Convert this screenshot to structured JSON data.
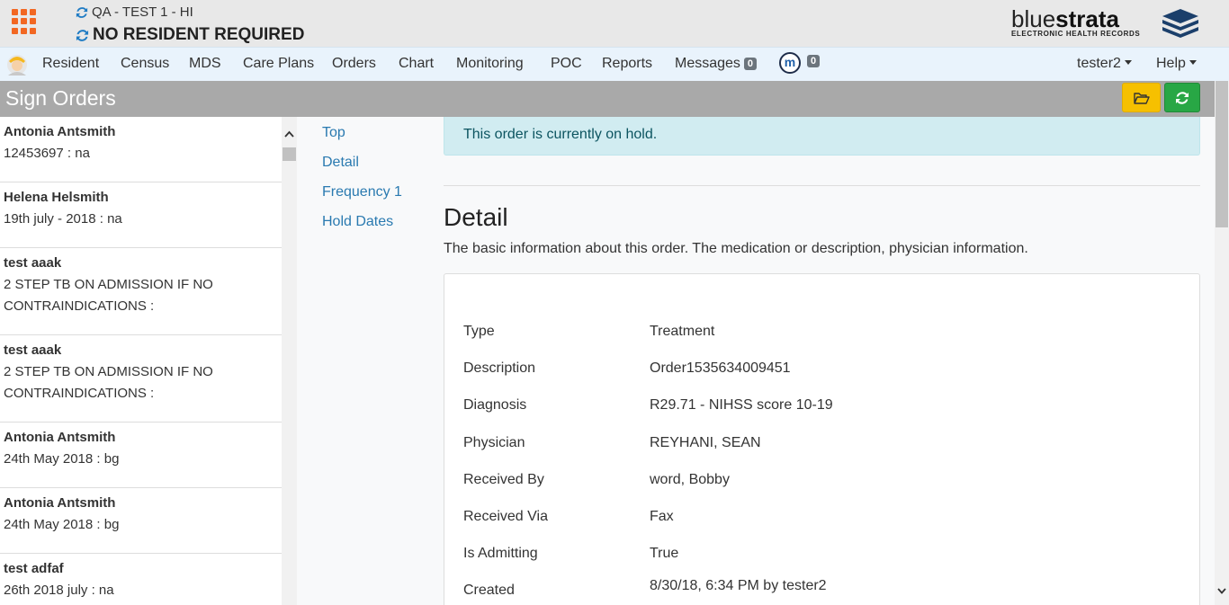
{
  "header": {
    "facility": "QA - TEST 1 - HI",
    "resident": "NO RESIDENT REQUIRED",
    "logo_left": "blue",
    "logo_right": "strata",
    "logo_tagline": "ELECTRONIC HEALTH RECORDS"
  },
  "nav": {
    "items": [
      "Resident",
      "Census",
      "MDS",
      "Care Plans",
      "Orders",
      "Chart",
      "Monitoring",
      "POC",
      "Reports"
    ],
    "messages_label": "Messages",
    "messages_count": "0",
    "m_label": "m",
    "m_count": "0",
    "user": "tester2",
    "help": "Help"
  },
  "page": {
    "title": "Sign Orders"
  },
  "orders": [
    {
      "name": "Antonia Antsmith",
      "detail": "12453697 : na"
    },
    {
      "name": "Helena Helsmith",
      "detail": "19th july - 2018 : na"
    },
    {
      "name": "test aaak",
      "detail": "2 STEP TB ON ADMISSION IF NO CONTRAINDICATIONS :"
    },
    {
      "name": "test aaak",
      "detail": "2 STEP TB ON ADMISSION IF NO CONTRAINDICATIONS :"
    },
    {
      "name": "Antonia Antsmith",
      "detail": "24th May 2018 : bg"
    },
    {
      "name": "Antonia Antsmith",
      "detail": "24th May 2018 : bg"
    },
    {
      "name": "test adfaf",
      "detail": "26th 2018 july : na"
    }
  ],
  "side_links": [
    "Top",
    "Detail",
    "Frequency 1",
    "Hold Dates"
  ],
  "alert": "This order is currently on hold.",
  "detail": {
    "heading": "Detail",
    "description": "The basic information about this order. The medication or description, physician information.",
    "fields": [
      {
        "label": "Type",
        "value": "Treatment"
      },
      {
        "label": "Description",
        "value": "Order1535634009451"
      },
      {
        "label": "Diagnosis",
        "value": "R29.71 - NIHSS score 10-19"
      },
      {
        "label": "Physician",
        "value": "REYHANI, SEAN"
      },
      {
        "label": "Received By",
        "value": "word, Bobby"
      },
      {
        "label": "Received Via",
        "value": "Fax"
      },
      {
        "label": "Is Admitting",
        "value": "True"
      },
      {
        "label": "Created",
        "value": "8/30/18, 6:34 PM by tester2"
      }
    ]
  },
  "colors": {
    "accent_orange": "#f26722",
    "nav_bg": "#e9f3fc",
    "title_bar": "#a9a9a9",
    "warning_button": "#f6c000",
    "success_button": "#28a745",
    "link": "#2a7ab0",
    "info_bg": "#d1ecf1"
  }
}
